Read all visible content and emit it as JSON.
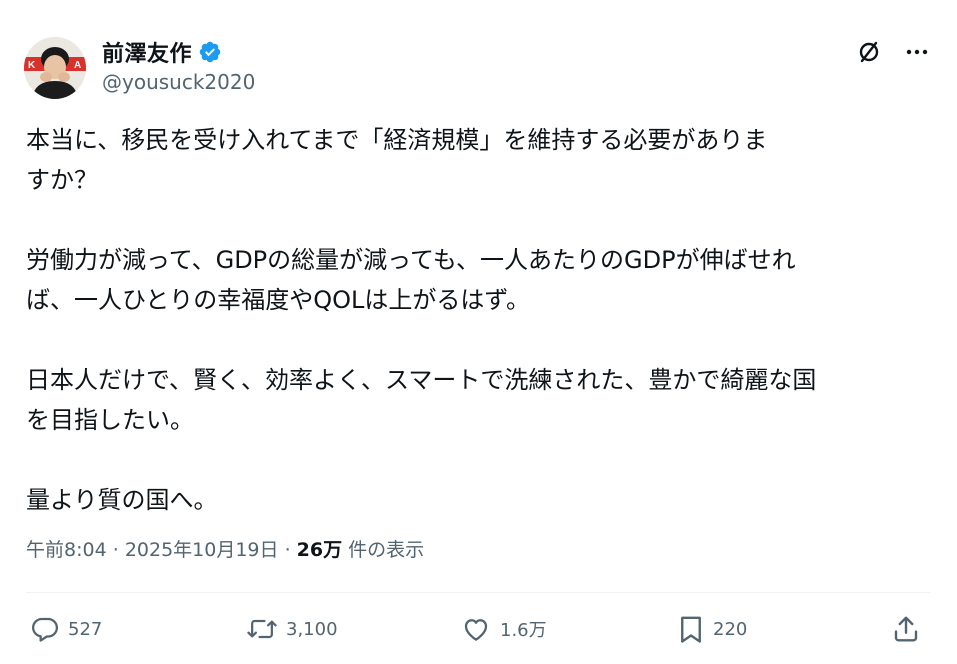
{
  "author": {
    "display_name": "前澤友作",
    "handle": "@yousuck2020",
    "verified": true,
    "avatar_badge_text": "KABUTA"
  },
  "header_actions": {
    "grok_icon": "grok-slash-icon",
    "more_icon": "more-icon"
  },
  "post": {
    "paragraphs": [
      [
        "本当に、移民を受け入れてまで「経済規模」を維持する必要がありま",
        "すか？"
      ],
      [
        "労働力が減って、GDPの総量が減っても、一人あたりのGDPが伸ばせれ",
        "ば、一人ひとりの幸福度やQOLは上がるはず。"
      ],
      [
        "日本人だけで、賢く、効率よく、スマートで洗練された、豊かで綺麗な国",
        "を目指したい。"
      ],
      [
        "量より質の国へ。"
      ]
    ]
  },
  "meta": {
    "time": "午前8:04",
    "separator": "·",
    "date": "2025年10月19日",
    "views_count": "26万",
    "views_label": "件の表示"
  },
  "actions": {
    "replies": "527",
    "reposts": "3,100",
    "likes": "1.6万",
    "bookmarks": "220"
  },
  "colors": {
    "text_primary": "#0f1419",
    "text_secondary": "#536471",
    "verified_blue": "#1d9bf0",
    "divider": "#eff3f4"
  }
}
